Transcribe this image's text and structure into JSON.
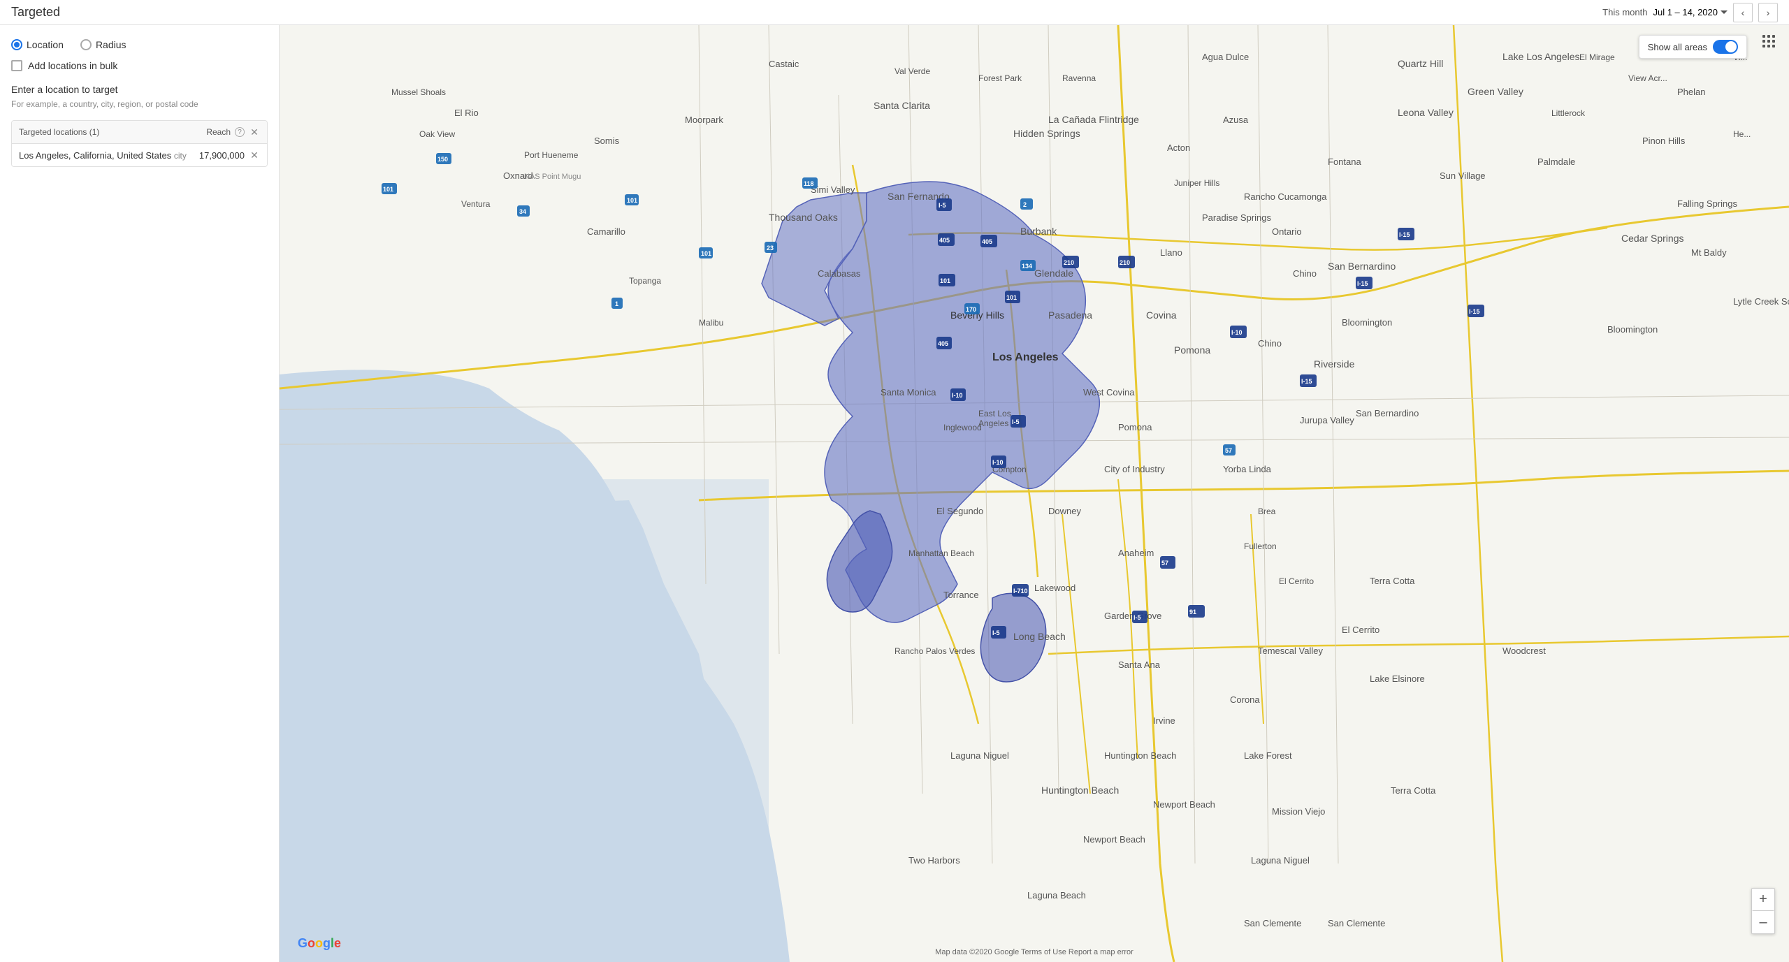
{
  "header": {
    "title": "Targeted",
    "date_range_label": "This month",
    "date_range": "Jul 1 – 14, 2020"
  },
  "left_panel": {
    "radio_location_label": "Location",
    "radio_radius_label": "Radius",
    "checkbox_bulk_label": "Add locations in bulk",
    "input_section_label": "Enter a location to target",
    "input_hint": "For example, a country, city, region, or postal code",
    "table_header_label": "Targeted locations (1)",
    "reach_label": "Reach",
    "location_name": "Los Angeles, California, United States",
    "location_type": "city",
    "location_reach": "17,900,000"
  },
  "map": {
    "show_all_areas_label": "Show all areas",
    "zoom_in_label": "+",
    "zoom_out_label": "–",
    "attribution": "Map data ©2020 Google  Terms of Use  Report a map error"
  }
}
